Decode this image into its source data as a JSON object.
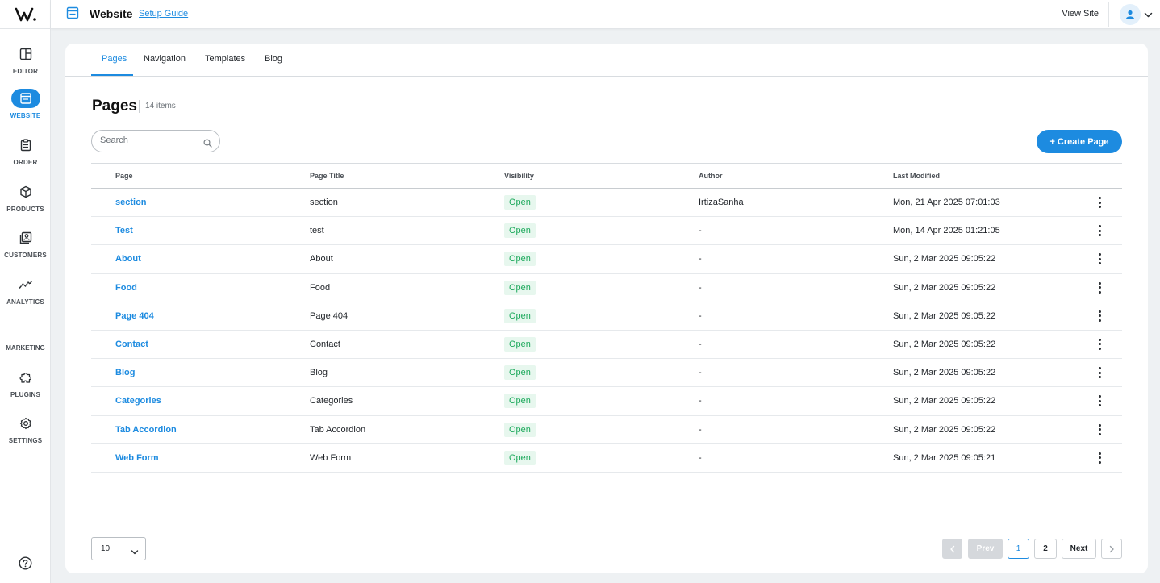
{
  "topbar": {
    "title": "Website",
    "setup_guide": "Setup Guide",
    "view_site": "View Site"
  },
  "sidebar": {
    "items": [
      {
        "label": "EDITOR",
        "icon": "layout-icon"
      },
      {
        "label": "WEBSITE",
        "icon": "browser-icon",
        "active": true
      },
      {
        "label": "ORDER",
        "icon": "clipboard-icon"
      },
      {
        "label": "PRODUCTS",
        "icon": "box-icon"
      },
      {
        "label": "CUSTOMERS",
        "icon": "contacts-icon"
      },
      {
        "label": "ANALYTICS",
        "icon": "trend-icon"
      },
      {
        "label": "MARKETING"
      },
      {
        "label": "PLUGINS",
        "icon": "puzzle-icon"
      },
      {
        "label": "SETTINGS",
        "icon": "gear-icon"
      }
    ]
  },
  "tabs": [
    "Pages",
    "Navigation",
    "Templates",
    "Blog"
  ],
  "main": {
    "heading": "Pages",
    "count": "14 items",
    "search_placeholder": "Search",
    "create_button": "+ Create Page"
  },
  "table": {
    "columns": [
      "Page",
      "Page Title",
      "Visibility",
      "Author",
      "Last Modified"
    ],
    "rows": [
      [
        "section",
        "section",
        "Open",
        "IrtizaSanha",
        "Mon, 21 Apr 2025 07:01:03"
      ],
      [
        "Test",
        "test",
        "Open",
        "-",
        "Mon, 14 Apr 2025 01:21:05"
      ],
      [
        "About",
        "About",
        "Open",
        "-",
        "Sun, 2 Mar 2025 09:05:22"
      ],
      [
        "Food",
        "Food",
        "Open",
        "-",
        "Sun, 2 Mar 2025 09:05:22"
      ],
      [
        "Page 404",
        "Page 404",
        "Open",
        "-",
        "Sun, 2 Mar 2025 09:05:22"
      ],
      [
        "Contact",
        "Contact",
        "Open",
        "-",
        "Sun, 2 Mar 2025 09:05:22"
      ],
      [
        "Blog",
        "Blog",
        "Open",
        "-",
        "Sun, 2 Mar 2025 09:05:22"
      ],
      [
        "Categories",
        "Categories",
        "Open",
        "-",
        "Sun, 2 Mar 2025 09:05:22"
      ],
      [
        "Tab Accordion",
        "Tab Accordion",
        "Open",
        "-",
        "Sun, 2 Mar 2025 09:05:22"
      ],
      [
        "Web Form",
        "Web Form",
        "Open",
        "-",
        "Sun, 2 Mar 2025 09:05:21"
      ]
    ]
  },
  "footer": {
    "per_page": "10",
    "prev": "Prev",
    "next": "Next",
    "pages": [
      "1",
      "2"
    ],
    "current_page": "1"
  },
  "colors": {
    "accent": "#1d8be0",
    "badge_text": "#1aa85a",
    "badge_bg": "#e7f7ee"
  }
}
